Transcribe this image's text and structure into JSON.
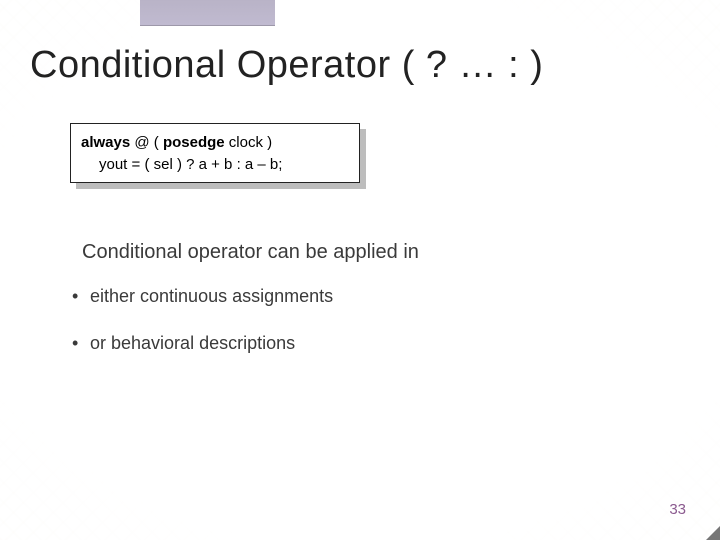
{
  "title": "Conditional Operator ( ? … : )",
  "code": {
    "line1_strong": "always",
    "line1_mid": " @ ( ",
    "line1_strong2": "posedge",
    "line1_rest": " clock )",
    "line2": "yout = ( sel ) ? a + b : a – b;"
  },
  "intro": "Conditional operator can be applied in",
  "bullets": [
    "either continuous assignments",
    "or behavioral descriptions"
  ],
  "page_number": "33"
}
